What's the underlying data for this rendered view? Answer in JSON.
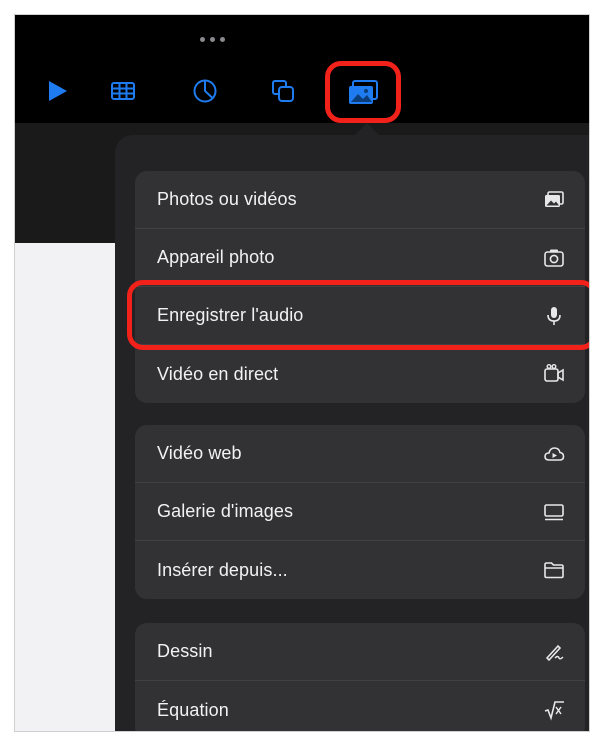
{
  "toolbar": {
    "icons": [
      "play-icon",
      "table-icon",
      "chart-icon",
      "shapes-icon",
      "media-icon"
    ],
    "accent": "#1f7cf0",
    "highlight_color": "#f2221a"
  },
  "menu": {
    "group1": [
      {
        "label": "Photos ou vidéos",
        "icon": "photo-icon"
      },
      {
        "label": "Appareil photo",
        "icon": "camera-icon"
      },
      {
        "label": "Enregistrer l'audio",
        "icon": "microphone-icon"
      },
      {
        "label": "Vidéo en direct",
        "icon": "live-video-icon"
      }
    ],
    "group2": [
      {
        "label": "Vidéo web",
        "icon": "cloud-play-icon"
      },
      {
        "label": "Galerie d'images",
        "icon": "gallery-icon"
      },
      {
        "label": "Insérer depuis...",
        "icon": "folder-icon"
      }
    ],
    "group3": [
      {
        "label": "Dessin",
        "icon": "pen-icon"
      },
      {
        "label": "Équation",
        "icon": "square-root-icon"
      }
    ]
  }
}
